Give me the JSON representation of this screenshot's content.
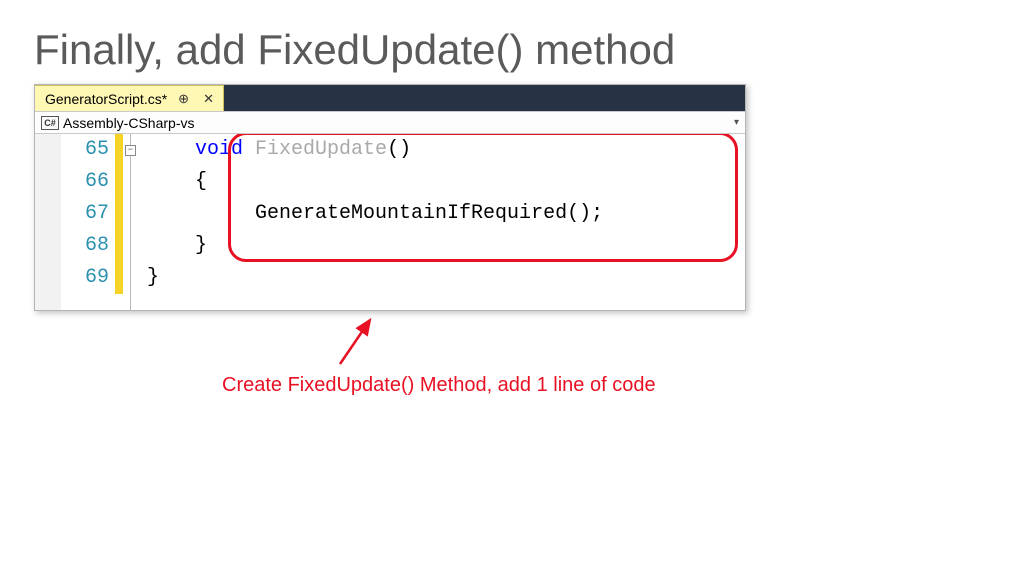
{
  "title": "Finally, add FixedUpdate() method",
  "tab": {
    "filename": "GeneratorScript.cs*",
    "pin_glyph": "⊕",
    "close_glyph": "✕"
  },
  "context": {
    "badge": "C#",
    "scope": "Assembly-CSharp-vs",
    "dropdown_glyph": "▾"
  },
  "lines": {
    "n65": "65",
    "n66": "66",
    "n67": "67",
    "n68": "68",
    "n69": "69",
    "fold_glyph": "−"
  },
  "code": {
    "l65_kw": "void",
    "l65_name": " FixedUpdate",
    "l65_tail": "()",
    "l66": "    {",
    "l67": "         GenerateMountainIfRequired();",
    "l68": "    }",
    "l69": "}"
  },
  "annotation": "Create FixedUpdate() Method, add 1 line of code"
}
